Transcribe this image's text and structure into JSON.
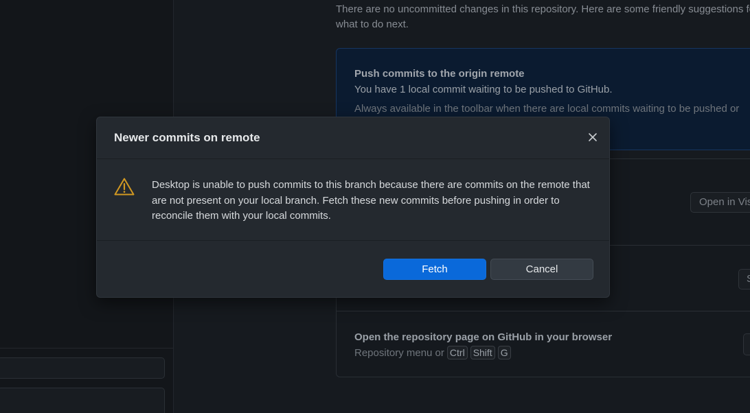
{
  "background": {
    "intro_text": "There are no uncommitted changes in this repository. Here are some friendly suggestions for what to do next.",
    "push_card": {
      "title": "Push commits to the origin remote",
      "description": "You have 1 local commit waiting to be pushed to GitHub.",
      "hint": "Always available in the toolbar when there are local commits waiting to be pushed or"
    },
    "open_editor_button_label": "Open in Vis",
    "show_button_label": "S",
    "github_card": {
      "title": "Open the repository page on GitHub in your browser",
      "shortcut_prefix": "Repository menu or",
      "keys": [
        "Ctrl",
        "Shift",
        "G"
      ]
    }
  },
  "dialog": {
    "title": "Newer commits on remote",
    "close_icon": "close-icon",
    "warning_icon": "warning-icon",
    "message": "Desktop is unable to push commits to this branch because there are commits on the remote that are not present on your local branch. Fetch these new commits before pushing in order to reconcile them with your local commits.",
    "primary_button": "Fetch",
    "secondary_button": "Cancel"
  },
  "colors": {
    "accent": "#0a69da",
    "warning": "#d29922",
    "dialog_bg": "#24292f"
  }
}
